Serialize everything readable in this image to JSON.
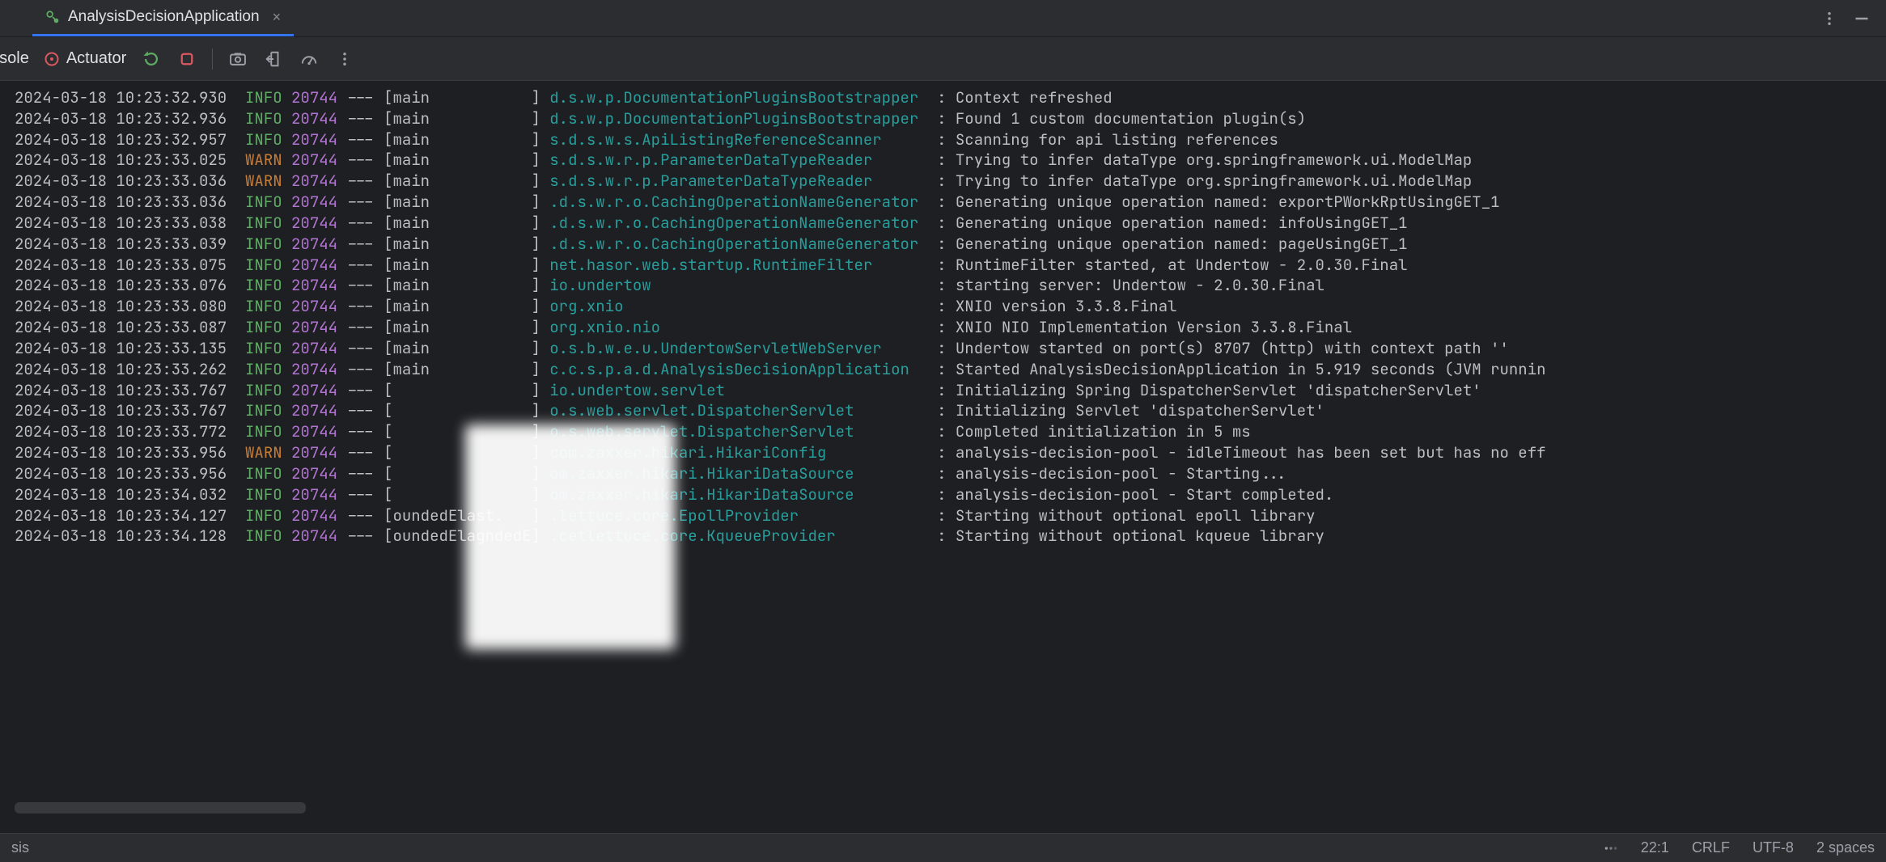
{
  "tab": {
    "title": "AnalysisDecisionApplication"
  },
  "toolbar": {
    "console": "nsole",
    "actuator": "Actuator"
  },
  "status": {
    "left": "sis",
    "pos": "22:1",
    "eol": "CRLF",
    "enc": "UTF-8",
    "indent": "2 spaces"
  },
  "cols": {
    "logger_width": 41
  },
  "log": [
    {
      "ts": "2024-03-18 10:23:32.930",
      "lvl": "INFO",
      "pid": "20744",
      "thr": "main",
      "logger": "d.s.w.p.DocumentationPluginsBootstrapper",
      "msg": "Context refreshed"
    },
    {
      "ts": "2024-03-18 10:23:32.936",
      "lvl": "INFO",
      "pid": "20744",
      "thr": "main",
      "logger": "d.s.w.p.DocumentationPluginsBootstrapper",
      "msg": "Found 1 custom documentation plugin(s)"
    },
    {
      "ts": "2024-03-18 10:23:32.957",
      "lvl": "INFO",
      "pid": "20744",
      "thr": "main",
      "logger": "s.d.s.w.s.ApiListingReferenceScanner",
      "msg": "Scanning for api listing references"
    },
    {
      "ts": "2024-03-18 10:23:33.025",
      "lvl": "WARN",
      "pid": "20744",
      "thr": "main",
      "logger": "s.d.s.w.r.p.ParameterDataTypeReader",
      "msg": "Trying to infer dataType org.springframework.ui.ModelMap"
    },
    {
      "ts": "2024-03-18 10:23:33.036",
      "lvl": "WARN",
      "pid": "20744",
      "thr": "main",
      "logger": "s.d.s.w.r.p.ParameterDataTypeReader",
      "msg": "Trying to infer dataType org.springframework.ui.ModelMap"
    },
    {
      "ts": "2024-03-18 10:23:33.036",
      "lvl": "INFO",
      "pid": "20744",
      "thr": "main",
      "logger": ".d.s.w.r.o.CachingOperationNameGenerator",
      "msg": "Generating unique operation named: exportPWorkRptUsingGET_1"
    },
    {
      "ts": "2024-03-18 10:23:33.038",
      "lvl": "INFO",
      "pid": "20744",
      "thr": "main",
      "logger": ".d.s.w.r.o.CachingOperationNameGenerator",
      "msg": "Generating unique operation named: infoUsingGET_1"
    },
    {
      "ts": "2024-03-18 10:23:33.039",
      "lvl": "INFO",
      "pid": "20744",
      "thr": "main",
      "logger": ".d.s.w.r.o.CachingOperationNameGenerator",
      "msg": "Generating unique operation named: pageUsingGET_1"
    },
    {
      "ts": "2024-03-18 10:23:33.075",
      "lvl": "INFO",
      "pid": "20744",
      "thr": "main",
      "logger": "net.hasor.web.startup.RuntimeFilter",
      "msg": "RuntimeFilter started, at Undertow - 2.0.30.Final"
    },
    {
      "ts": "2024-03-18 10:23:33.076",
      "lvl": "INFO",
      "pid": "20744",
      "thr": "main",
      "logger": "io.undertow",
      "msg": "starting server: Undertow - 2.0.30.Final"
    },
    {
      "ts": "2024-03-18 10:23:33.080",
      "lvl": "INFO",
      "pid": "20744",
      "thr": "main",
      "logger": "org.xnio",
      "msg": "XNIO version 3.3.8.Final"
    },
    {
      "ts": "2024-03-18 10:23:33.087",
      "lvl": "INFO",
      "pid": "20744",
      "thr": "main",
      "logger": "org.xnio.nio",
      "msg": "XNIO NIO Implementation Version 3.3.8.Final"
    },
    {
      "ts": "2024-03-18 10:23:33.135",
      "lvl": "INFO",
      "pid": "20744",
      "thr": "main",
      "logger": "o.s.b.w.e.u.UndertowServletWebServer",
      "msg": "Undertow started on port(s) 8707 (http) with context path ''"
    },
    {
      "ts": "2024-03-18 10:23:33.262",
      "lvl": "INFO",
      "pid": "20744",
      "thr": "main",
      "logger": "c.c.s.p.a.d.AnalysisDecisionApplication",
      "msg": "Started AnalysisDecisionApplication in 5.919 seconds (JVM runnin"
    },
    {
      "ts": "2024-03-18 10:23:33.767",
      "lvl": "INFO",
      "pid": "20744",
      "thr": "",
      "logger": "io.undertow.servlet",
      "msg": "Initializing Spring DispatcherServlet 'dispatcherServlet'"
    },
    {
      "ts": "2024-03-18 10:23:33.767",
      "lvl": "INFO",
      "pid": "20744",
      "thr": "",
      "logger": "o.s.web.servlet.DispatcherServlet",
      "msg": "Initializing Servlet 'dispatcherServlet'"
    },
    {
      "ts": "2024-03-18 10:23:33.772",
      "lvl": "INFO",
      "pid": "20744",
      "thr": "",
      "logger": "o.s.web.servlet.DispatcherServlet",
      "msg": "Completed initialization in 5 ms"
    },
    {
      "ts": "2024-03-18 10:23:33.956",
      "lvl": "WARN",
      "pid": "20744",
      "thr": "",
      "logger": "com.zaxxer.hikari.HikariConfig",
      "msg": "analysis-decision-pool - idleTimeout has been set but has no eff"
    },
    {
      "ts": "2024-03-18 10:23:33.956",
      "lvl": "INFO",
      "pid": "20744",
      "thr": "",
      "logger": "om.zaxxer.hikari.HikariDataSource",
      "msg": "analysis-decision-pool - Starting..."
    },
    {
      "ts": "2024-03-18 10:23:34.032",
      "lvl": "INFO",
      "pid": "20744",
      "thr": "",
      "logger": "om.zaxxer.hikari.HikariDataSource",
      "msg": "analysis-decision-pool - Start completed."
    },
    {
      "ts": "2024-03-18 10:23:34.127",
      "lvl": "INFO",
      "pid": "20744",
      "thr": "oundedElast.",
      "logger": ".lettuce.core.EpollProvider",
      "msg": "Starting without optional epoll library"
    },
    {
      "ts": "2024-03-18 10:23:34.128",
      "lvl": "INFO",
      "pid": "20744",
      "thr": "oundedElagndedE",
      "logger": ".cetlettuce.core.KqueueProvider",
      "msg": "Starting without optional kqueue library"
    }
  ]
}
